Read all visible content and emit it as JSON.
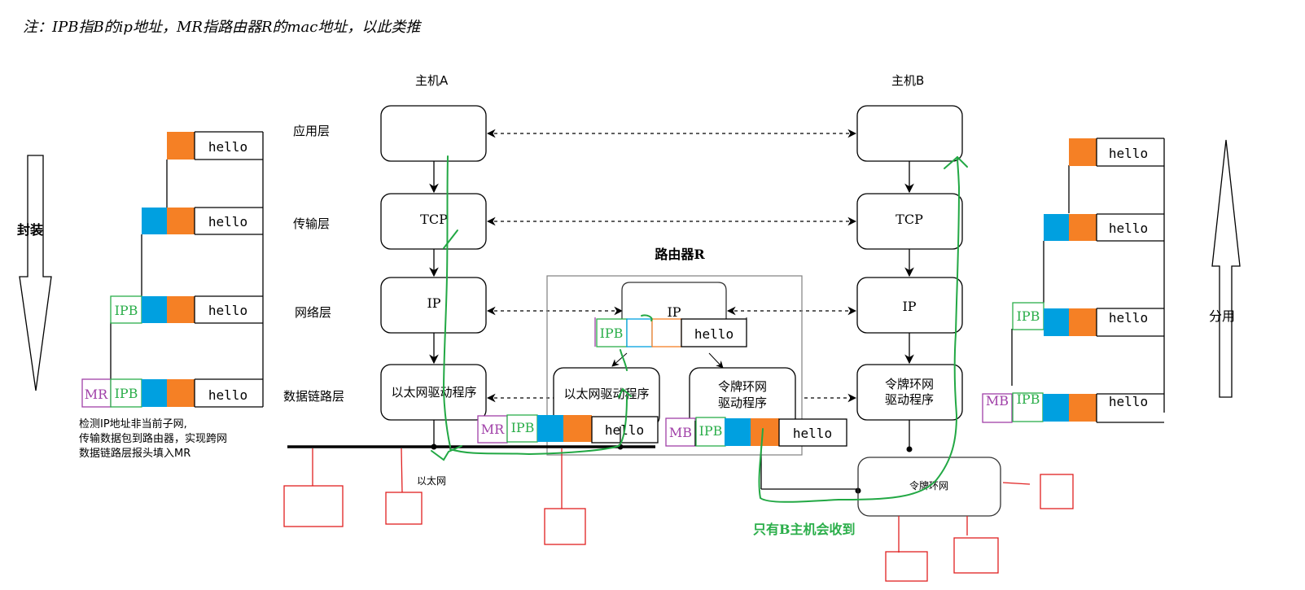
{
  "note": "注：IPB指B的ip地址，MR指路由器R的mac地址，以此类推",
  "colors": {
    "orange": "#F58025",
    "blue": "#00A0E0",
    "green_header": "#2BAE4A",
    "purple_header": "#A040A8",
    "green_path": "#22A844",
    "red_host": "#E02020",
    "router_frame": "#808080"
  },
  "left_arrow": {
    "label": "封装",
    "direction": "down"
  },
  "right_arrow": {
    "label": "分用",
    "direction": "up"
  },
  "layers": [
    "应用层",
    "传输层",
    "网络层",
    "数据链路层"
  ],
  "host_a": {
    "title": "主机A",
    "boxes": [
      "",
      "TCP",
      "IP",
      "以太网驱动程序"
    ]
  },
  "host_b": {
    "title": "主机B",
    "boxes": [
      "",
      "TCP",
      "IP",
      "令牌环网\n驱动程序"
    ],
    "boxes_split": [
      "",
      "TCP",
      "IP",
      "令牌环网",
      "驱动程序"
    ]
  },
  "router": {
    "title": "路由器R",
    "ip_box": "IP",
    "eth_driver": "以太网驱动程序",
    "token_driver_line1": "令牌环网",
    "token_driver_line2": "驱动程序",
    "packet": {
      "ip": "IPB",
      "payload": "hello"
    }
  },
  "payload": "hello",
  "encap_stack_left": [
    {
      "mac": "",
      "ip": "",
      "payload": "hello"
    },
    {
      "mac": "",
      "ip": "",
      "payload": "hello"
    },
    {
      "mac": "",
      "ip": "IPB",
      "payload": "hello"
    },
    {
      "mac": "MR",
      "ip": "IPB",
      "payload": "hello"
    }
  ],
  "encap_stack_right": [
    {
      "mac": "",
      "ip": "",
      "payload": "hello"
    },
    {
      "mac": "",
      "ip": "",
      "payload": "hello"
    },
    {
      "mac": "",
      "ip": "IPB",
      "payload": "hello"
    },
    {
      "mac": "MB",
      "ip": "IPB",
      "payload": "hello"
    }
  ],
  "frame_ethernet": {
    "mac": "MR",
    "ip": "IPB",
    "payload": "hello"
  },
  "frame_token": {
    "mac": "MB",
    "ip": "IPB",
    "payload": "hello"
  },
  "left_caption": [
    "检测IP地址非当前子网,",
    "传输数据包到路由器，实现跨网",
    "数据链路层报头填入MR"
  ],
  "ethernet_label": "以太网",
  "token_ring_label": "令牌环网",
  "receive_note": "只有B主机会收到"
}
